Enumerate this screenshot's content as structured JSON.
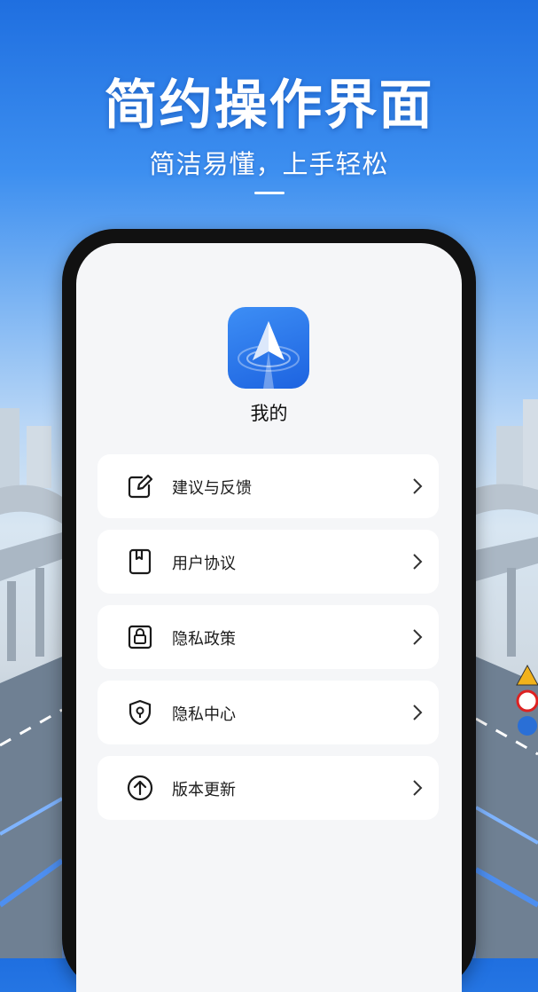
{
  "promo": {
    "headline": "简约操作界面",
    "subline": "简洁易懂，上手轻松"
  },
  "profile": {
    "title": "我的",
    "app_icon": "navigation-arrow-icon"
  },
  "menu": {
    "items": [
      {
        "label": "建议与反馈",
        "icon": "edit-icon"
      },
      {
        "label": "用户协议",
        "icon": "book-icon"
      },
      {
        "label": "隐私政策",
        "icon": "lock-icon"
      },
      {
        "label": "隐私中心",
        "icon": "shield-icon"
      },
      {
        "label": "版本更新",
        "icon": "upload-arrow-icon"
      }
    ]
  },
  "colors": {
    "accent": "#1d63e0",
    "icon_stroke": "#1a1a1a",
    "card": "#ffffff",
    "screen_bg": "#f5f6f8"
  }
}
